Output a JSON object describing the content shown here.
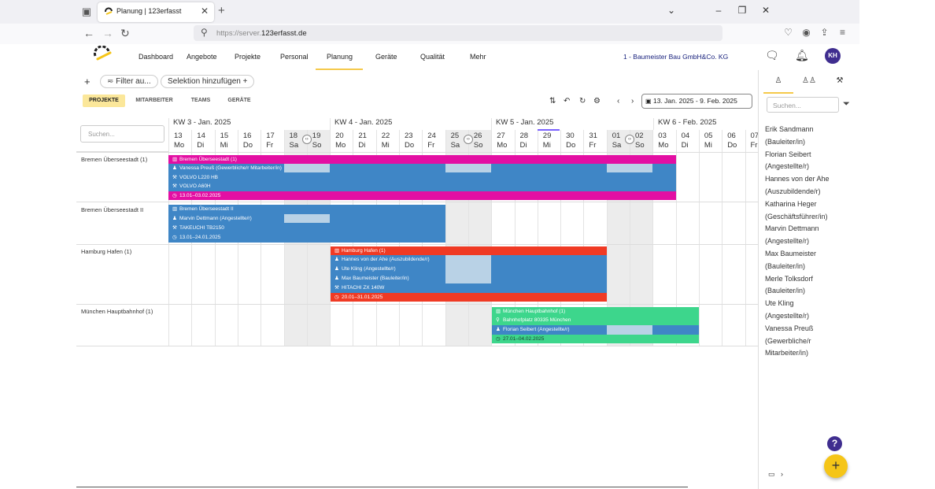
{
  "browser": {
    "tab_title": "Planung | 123erfasst",
    "url_prefix": "https://server.",
    "url_domain": "123erfasst.de"
  },
  "header": {
    "nav": [
      "Dashboard",
      "Angebote",
      "Projekte",
      "Personal",
      "Planung",
      "Geräte",
      "Qualität",
      "Mehr"
    ],
    "active_nav": "Planung",
    "company": "1 - Baumeister Bau GmbH&Co. KG",
    "avatar_initials": "KH"
  },
  "filters": {
    "filter_label": "Filter au...",
    "selection_label": "Selektion hinzufügen"
  },
  "view_tabs": [
    "PROJEKTE",
    "MITARBEITER",
    "TEAMS",
    "GERÄTE"
  ],
  "date_range": "13. Jan. 2025 - 9. Feb. 2025",
  "grid": {
    "search_placeholder": "Suchen...",
    "weeks": [
      "KW 3 - Jan. 2025",
      "KW 4 - Jan. 2025",
      "KW 5 - Jan. 2025",
      "KW 6 - Feb. 2025"
    ],
    "days": [
      {
        "n": "13",
        "d": "Mo"
      },
      {
        "n": "14",
        "d": "Di"
      },
      {
        "n": "15",
        "d": "Mi"
      },
      {
        "n": "16",
        "d": "Do"
      },
      {
        "n": "17",
        "d": "Fr"
      },
      {
        "n": "18",
        "d": "Sa"
      },
      {
        "n": "19",
        "d": "So"
      },
      {
        "n": "20",
        "d": "Mo"
      },
      {
        "n": "21",
        "d": "Di"
      },
      {
        "n": "22",
        "d": "Mi"
      },
      {
        "n": "23",
        "d": "Do"
      },
      {
        "n": "24",
        "d": "Fr"
      },
      {
        "n": "25",
        "d": "Sa"
      },
      {
        "n": "26",
        "d": "So"
      },
      {
        "n": "27",
        "d": "Mo"
      },
      {
        "n": "28",
        "d": "Di"
      },
      {
        "n": "29",
        "d": "Mi"
      },
      {
        "n": "30",
        "d": "Do"
      },
      {
        "n": "31",
        "d": "Fr"
      },
      {
        "n": "01",
        "d": "Sa"
      },
      {
        "n": "02",
        "d": "So"
      },
      {
        "n": "03",
        "d": "Mo"
      },
      {
        "n": "04",
        "d": "Di"
      },
      {
        "n": "05",
        "d": "Mi"
      },
      {
        "n": "06",
        "d": "Do"
      },
      {
        "n": "07",
        "d": "Fr"
      }
    ]
  },
  "projects": [
    {
      "name": "Bremen Überseestadt (1)",
      "header": "Bremen Überseestadt (1)",
      "lines": [
        "Vanessa Preuß (Gewerbliche/r Mitarbeiter/in)",
        "VOLVO L220 HB",
        "VOLVO A60H"
      ],
      "dates": "13.01–03.02.2025",
      "color": "#e30fa3"
    },
    {
      "name": "Bremen Überseestadt II",
      "header": "Bremen Überseestadt II",
      "lines": [
        "Marvin Dettmann (Angestellte/r)",
        "TAKEUCHI TB2150"
      ],
      "dates": "13.01–24.01.2025",
      "color": "#3f86c6"
    },
    {
      "name": "Hamburg Hafen (1)",
      "header": "Hamburg Hafen (1)",
      "lines": [
        "Hannes von der Ahe (Auszubildende/r)",
        "Ute Kling (Angestellte/r)",
        "Max Baumeister (Bauleiter/in)",
        "HITACHI ZX 140W"
      ],
      "dates": "20.01–31.01.2025",
      "color": "#f03a24"
    },
    {
      "name": "München Hauptbahnhof (1)",
      "header": "München Hauptbahnhof (1)",
      "address": "Bahnhofplatz 80335 München",
      "lines": [
        "Florian Seibert (Angestellte/r)"
      ],
      "dates": "27.01–04.02.2025",
      "color": "#3dd68c"
    }
  ],
  "panel": {
    "search_placeholder": "Suchen...",
    "employees": [
      "Erik Sandmann",
      "(Bauleiter/in)",
      "Florian Seibert",
      "(Angestellte/r)",
      "Hannes von der Ahe",
      "(Auszubildende/r)",
      "Katharina Heger",
      "(Geschäftsführer/in)",
      "Marvin Dettmann",
      "(Angestellte/r)",
      "Max Baumeister",
      "(Bauleiter/in)",
      "Merle Tolksdorf",
      "(Bauleiter/in)",
      "Ute Kling",
      "(Angestellte/r)",
      "Vanessa Preuß",
      "(Gewerbliche/r",
      "Mitarbeiter/in)"
    ]
  },
  "icons": {
    "help": "?",
    "fab": "+"
  }
}
